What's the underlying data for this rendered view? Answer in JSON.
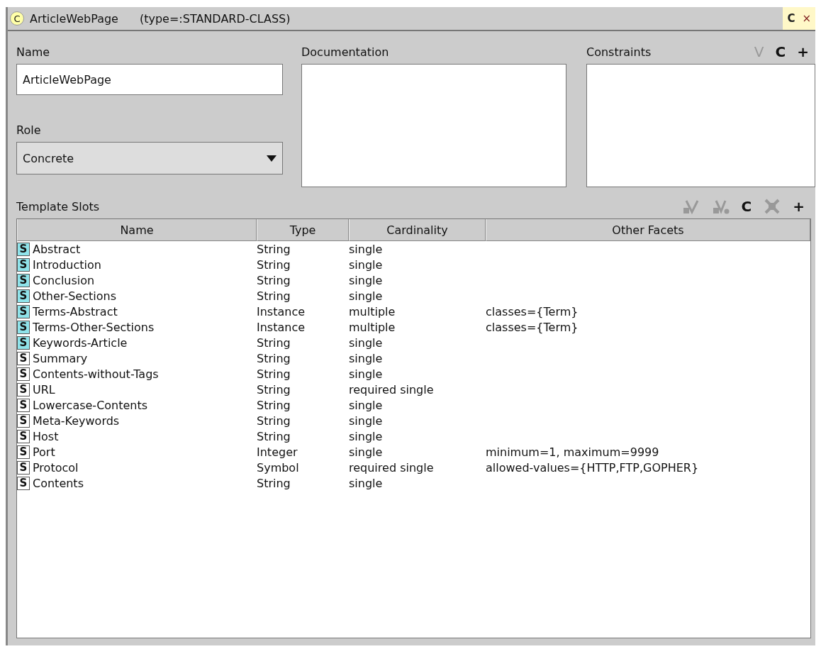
{
  "window": {
    "icon_letter": "C",
    "title": "ArticleWebPage",
    "type_label": "(type=:STANDARD-CLASS)",
    "buttons": [
      {
        "label": "C"
      },
      {
        "label": "×"
      }
    ]
  },
  "name": {
    "label": "Name",
    "value": "ArticleWebPage"
  },
  "role": {
    "label": "Role",
    "value": "Concrete"
  },
  "documentation": {
    "label": "Documentation"
  },
  "constraints": {
    "label": "Constraints",
    "buttons": [
      {
        "kind": "text",
        "label": "V",
        "disabled": true
      },
      {
        "kind": "text",
        "label": "C",
        "disabled": false
      },
      {
        "kind": "text",
        "label": "+",
        "disabled": false
      }
    ]
  },
  "template_slots": {
    "label": "Template Slots",
    "buttons": [
      {
        "kind": "view-slot",
        "disabled": true
      },
      {
        "kind": "view-facet",
        "disabled": true
      },
      {
        "kind": "text",
        "label": "C",
        "disabled": false
      },
      {
        "kind": "remove",
        "disabled": true
      },
      {
        "kind": "text",
        "label": "+",
        "disabled": false
      }
    ],
    "columns": [
      "Name",
      "Type",
      "Cardinality",
      "Other Facets"
    ],
    "rows": [
      {
        "icon_letter": "S",
        "highlighted": true,
        "name": "Abstract",
        "type": "String",
        "cardinality": "single",
        "facets": ""
      },
      {
        "icon_letter": "S",
        "highlighted": true,
        "name": "Introduction",
        "type": "String",
        "cardinality": "single",
        "facets": ""
      },
      {
        "icon_letter": "S",
        "highlighted": true,
        "name": "Conclusion",
        "type": "String",
        "cardinality": "single",
        "facets": ""
      },
      {
        "icon_letter": "S",
        "highlighted": true,
        "name": "Other-Sections",
        "type": "String",
        "cardinality": "single",
        "facets": ""
      },
      {
        "icon_letter": "S",
        "highlighted": true,
        "name": "Terms-Abstract",
        "type": "Instance",
        "cardinality": "multiple",
        "facets": "classes={Term}"
      },
      {
        "icon_letter": "S",
        "highlighted": true,
        "name": "Terms-Other-Sections",
        "type": "Instance",
        "cardinality": "multiple",
        "facets": "classes={Term}"
      },
      {
        "icon_letter": "S",
        "highlighted": true,
        "name": "Keywords-Article",
        "type": "String",
        "cardinality": "single",
        "facets": ""
      },
      {
        "icon_letter": "S",
        "highlighted": false,
        "name": "Summary",
        "type": "String",
        "cardinality": "single",
        "facets": ""
      },
      {
        "icon_letter": "S",
        "highlighted": false,
        "name": "Contents-without-Tags",
        "type": "String",
        "cardinality": "single",
        "facets": ""
      },
      {
        "icon_letter": "S",
        "highlighted": false,
        "name": "URL",
        "type": "String",
        "cardinality": "required single",
        "facets": ""
      },
      {
        "icon_letter": "S",
        "highlighted": false,
        "name": "Lowercase-Contents",
        "type": "String",
        "cardinality": "single",
        "facets": ""
      },
      {
        "icon_letter": "S",
        "highlighted": false,
        "name": "Meta-Keywords",
        "type": "String",
        "cardinality": "single",
        "facets": ""
      },
      {
        "icon_letter": "S",
        "highlighted": false,
        "name": "Host",
        "type": "String",
        "cardinality": "single",
        "facets": ""
      },
      {
        "icon_letter": "S",
        "highlighted": false,
        "name": "Port",
        "type": "Integer",
        "cardinality": "single",
        "facets": "minimum=1, maximum=9999"
      },
      {
        "icon_letter": "S",
        "highlighted": false,
        "name": "Protocol",
        "type": "Symbol",
        "cardinality": "required single",
        "facets": "allowed-values={HTTP,FTP,GOPHER}"
      },
      {
        "icon_letter": "S",
        "highlighted": false,
        "name": "Contents",
        "type": "String",
        "cardinality": "single",
        "facets": ""
      }
    ]
  }
}
